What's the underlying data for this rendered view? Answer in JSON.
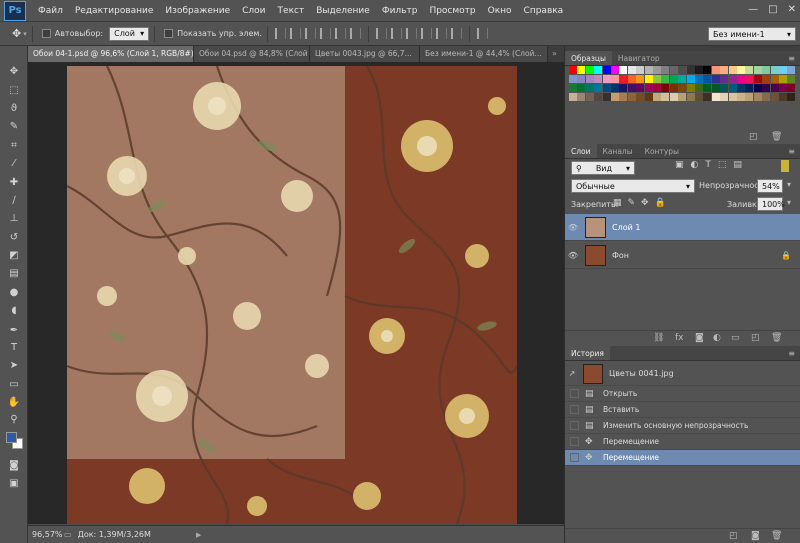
{
  "app": {
    "logo": "Ps",
    "window_controls": [
      "—",
      "□",
      "✕"
    ]
  },
  "menu": [
    "Файл",
    "Редактирование",
    "Изображение",
    "Слои",
    "Текст",
    "Выделение",
    "Фильтр",
    "Просмотр",
    "Окно",
    "Справка"
  ],
  "options": {
    "autoselect_label": "Автовыбор:",
    "autoselect_value": "Слой",
    "show_controls_label": "Показать упр. элем.",
    "workspace": "Без имени-1"
  },
  "tabs": [
    {
      "label": "Обои 04-1.psd @ 96,6% (Слой 1, RGB/8#) *",
      "active": true
    },
    {
      "label": "Обои 04.psd @ 84,8% (Слой ...",
      "active": false
    },
    {
      "label": "Цветы 0043.jpg @ 66,7...",
      "active": false
    },
    {
      "label": "Без имени-1 @ 44,4% (Слой...",
      "active": false
    }
  ],
  "status": {
    "zoom": "96,57%",
    "doc": "Док: 1,39M/3,26M"
  },
  "swatches_panel": {
    "tabs": [
      "Образцы",
      "Навигатор"
    ],
    "colors_row1": [
      "#ff0000",
      "#ffff00",
      "#00ff00",
      "#00ffff",
      "#0000ff",
      "#ff00ff",
      "#ffffff",
      "#e6e6e6",
      "#cccccc",
      "#b3b3b3",
      "#999999",
      "#808080",
      "#666666",
      "#4d4d4d",
      "#333333",
      "#1a1a1a",
      "#000000",
      "#f7977a",
      "#f9ad81",
      "#fdc68a",
      "#fff79a",
      "#c4df9b",
      "#a2d39c",
      "#82ca9d",
      "#7bcdc8",
      "#6ecff6",
      "#7ea7d8"
    ],
    "colors_row2": [
      "#8493ca",
      "#8882be",
      "#a187be",
      "#bc8dbf",
      "#f49ac2",
      "#f6989d",
      "#ed1c24",
      "#f26522",
      "#f7941d",
      "#fff200",
      "#8dc73f",
      "#39b54a",
      "#00a651",
      "#00a99d",
      "#00aeef",
      "#0072bc",
      "#0054a6",
      "#2e3192",
      "#662d91",
      "#92278f",
      "#ec008c",
      "#ed145b",
      "#9e0b0f",
      "#a0410d",
      "#a36209",
      "#aba000",
      "#598527"
    ],
    "colors_row3": [
      "#1a7b30",
      "#007236",
      "#00746b",
      "#0076a3",
      "#004b80",
      "#003471",
      "#1b1464",
      "#440e62",
      "#630460",
      "#9e005d",
      "#9e0039",
      "#790000",
      "#7b2e00",
      "#7d4900",
      "#827b00",
      "#406618",
      "#005e20",
      "#005826",
      "#005952",
      "#005b7f",
      "#003663",
      "#002157",
      "#0d004c",
      "#32004b",
      "#4b0049",
      "#7b0046",
      "#7a0026"
    ],
    "colors_row4": [
      "#c7b299",
      "#998675",
      "#736357",
      "#534741",
      "#37302d",
      "#c69c6d",
      "#a67c52",
      "#8c6239",
      "#754c24",
      "#603913",
      "#c2a87a",
      "#d3bfa0",
      "#e0cbb0",
      "#b89f74",
      "#8c7851",
      "#5e4f36",
      "#3b3022",
      "#f0e6d2",
      "#e5d2b4",
      "#d9c4a0",
      "#cbb28a",
      "#bca176",
      "#a38560",
      "#856a4b",
      "#6b5238",
      "#4e3b27",
      "#2f2417"
    ]
  },
  "layers_panel": {
    "tabs": [
      "Слои",
      "Каналы",
      "Контуры"
    ],
    "filter": "Вид",
    "blend_mode": "Обычные",
    "opacity_label": "Непрозрачность:",
    "opacity": "54%",
    "lock_label": "Закрепить:",
    "fill_label": "Заливка:",
    "fill": "100%",
    "layers": [
      {
        "name": "Слой 1",
        "selected": true,
        "thumb": "#b8937a"
      },
      {
        "name": "Фон",
        "selected": false,
        "thumb": "#8a4a30"
      }
    ]
  },
  "history_panel": {
    "tab": "История",
    "snapshot": "Цветы 0041.jpg",
    "steps": [
      {
        "label": "Открыть",
        "icon": "document-icon",
        "selected": false
      },
      {
        "label": "Вставить",
        "icon": "document-icon",
        "selected": false
      },
      {
        "label": "Изменить основную непрозрачность",
        "icon": "document-icon",
        "selected": false
      },
      {
        "label": "Перемещение",
        "icon": "move-icon",
        "selected": false
      },
      {
        "label": "Перемещение",
        "icon": "move-icon",
        "selected": true
      }
    ]
  },
  "colors": {
    "foreground": "#2a5aa8",
    "background": "#ffffff",
    "selection": "#6e8ab0",
    "panel_bg": "#535353",
    "canvas_bg": "#282828",
    "brown_fabric": "#7b3926",
    "light_fabric": "#a07560"
  }
}
